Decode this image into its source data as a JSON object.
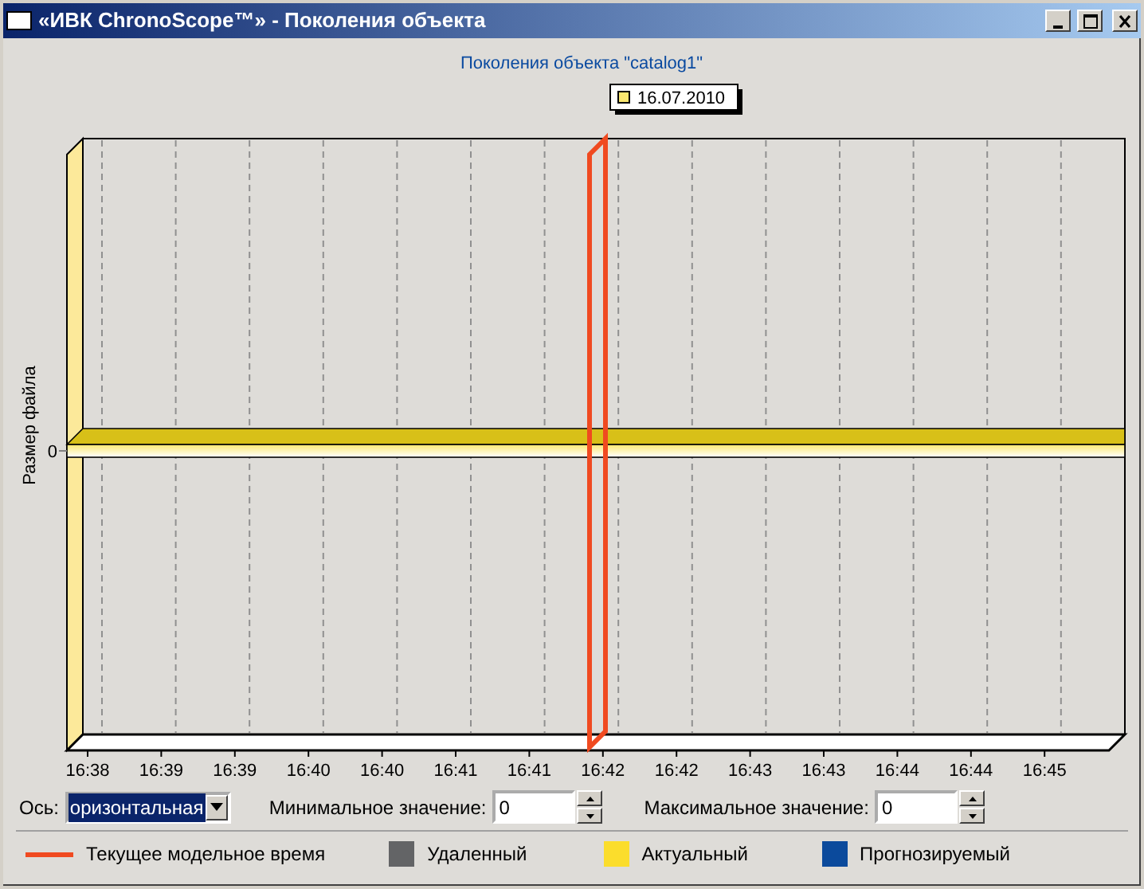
{
  "window": {
    "title": "«ИВК ChronoScope™» - Поколения объекта"
  },
  "chart": {
    "title": "Поколения объекта \"catalog1\"",
    "tooltip": "16.07.2010",
    "ylabel": "Размер файла",
    "ytick": "0",
    "xticks": [
      "16:38",
      "16:39",
      "16:39",
      "16:40",
      "16:40",
      "16:41",
      "16:41",
      "16:42",
      "16:42",
      "16:43",
      "16:43",
      "16:44",
      "16:44",
      "16:45"
    ]
  },
  "controls": {
    "axis_label": "Ось:",
    "axis_value": "оризонтальная",
    "min_label": "Минимальное значение:",
    "min_value": "0",
    "max_label": "Максимальное значение:",
    "max_value": "0"
  },
  "legend": [
    {
      "kind": "line",
      "label": "Текущее модельное время",
      "color": "#f04a20"
    },
    {
      "kind": "square",
      "label": "Удаленный",
      "color": "#636466"
    },
    {
      "kind": "square",
      "label": "Актуальный",
      "color": "#fbdd2c"
    },
    {
      "kind": "square",
      "label": "Прогнозируемый",
      "color": "#0b4a9c"
    }
  ]
}
